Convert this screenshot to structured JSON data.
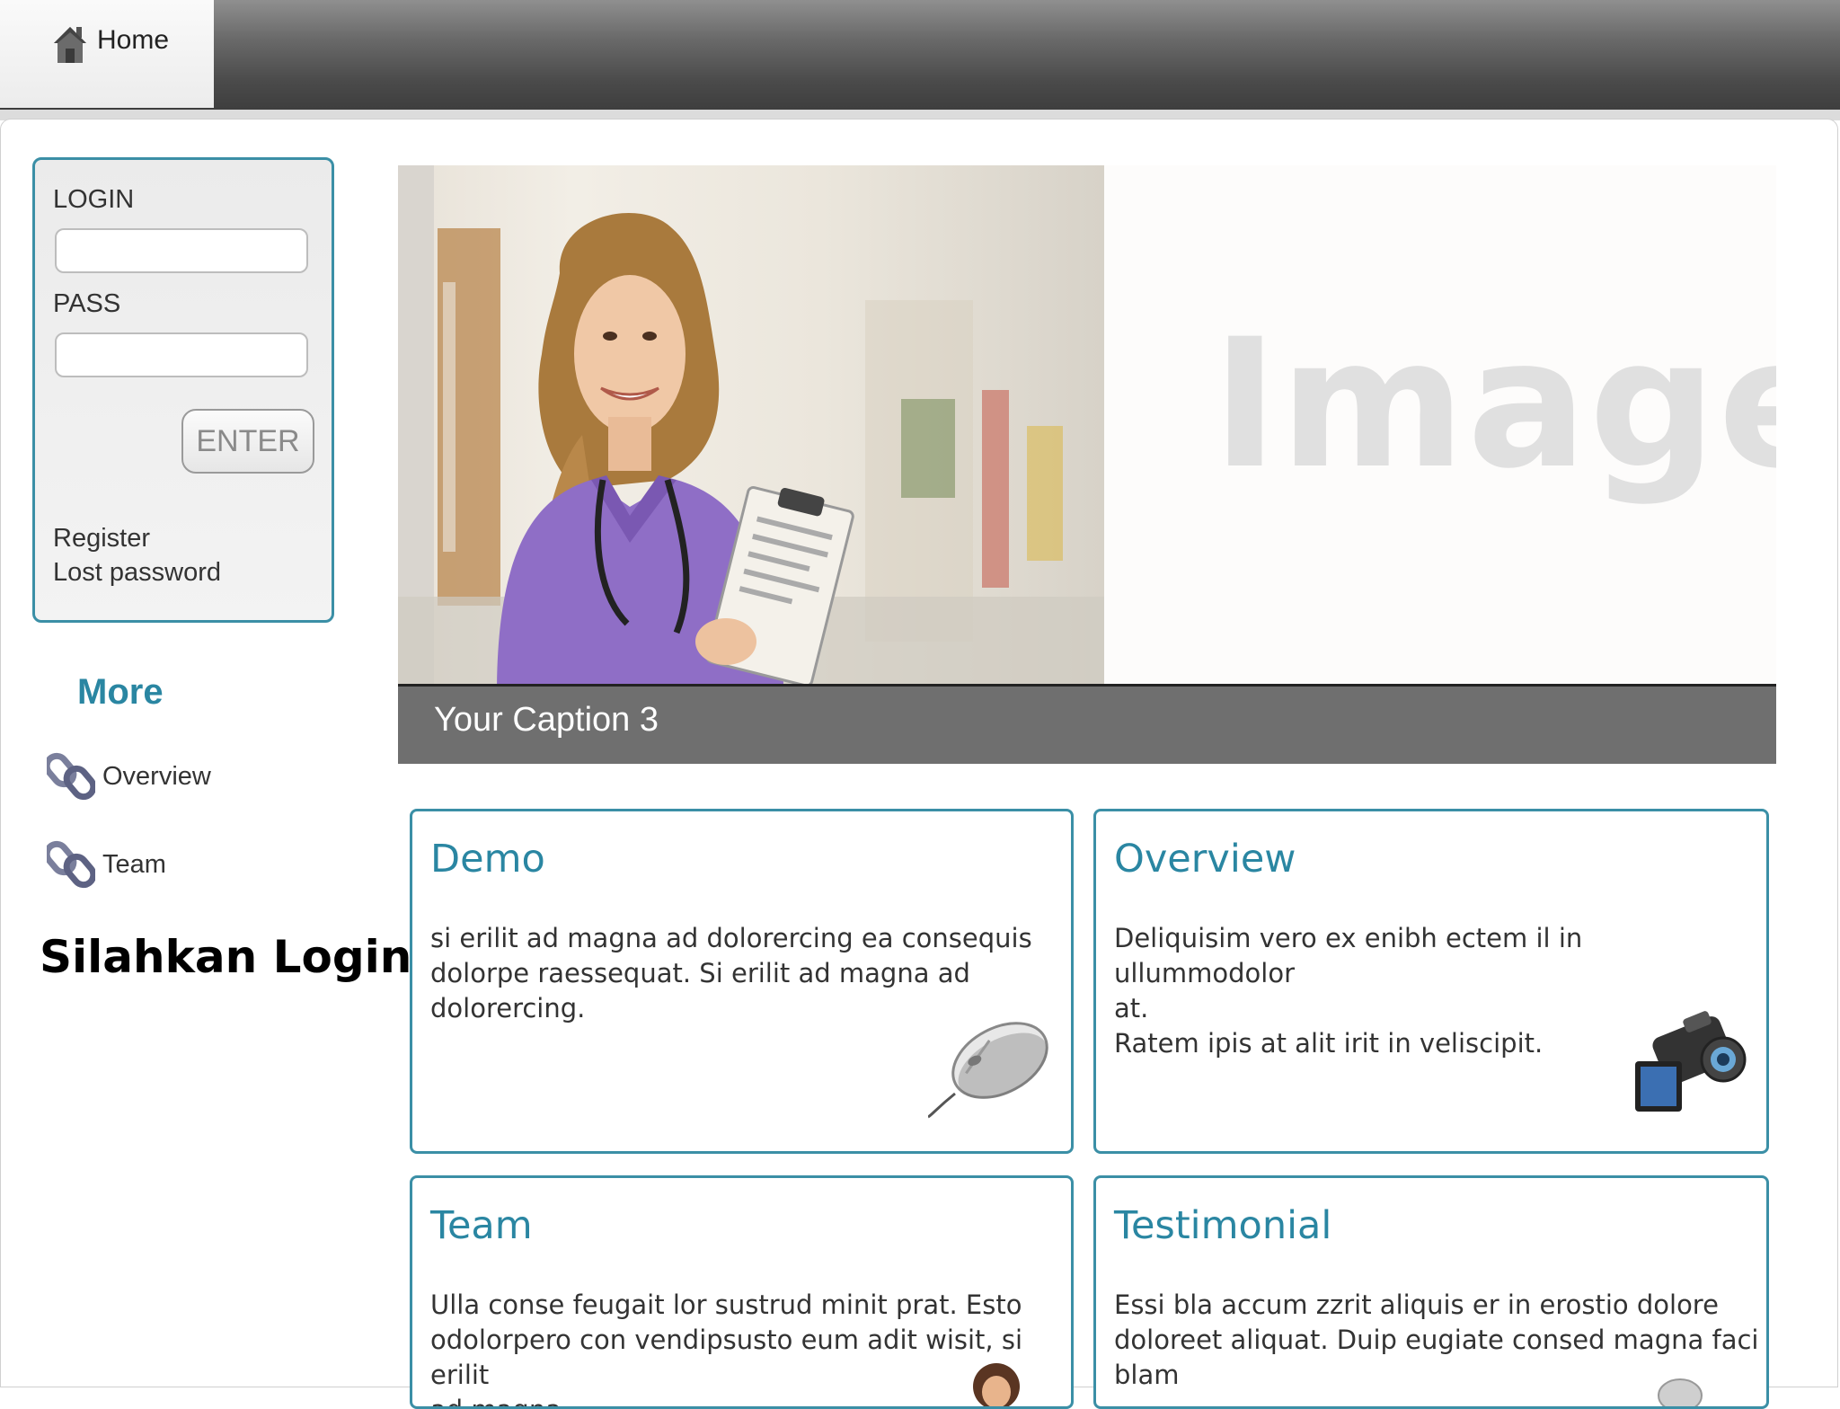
{
  "nav": {
    "home_label": "Home"
  },
  "login": {
    "login_label": "LOGIN",
    "login_value": "",
    "pass_label": "PASS",
    "pass_value": "",
    "enter_label": "ENTER",
    "register_label": "Register",
    "lost_password_label": "Lost password"
  },
  "more": {
    "title": "More",
    "items": [
      {
        "label": "Overview",
        "icon": "chain-link-icon"
      },
      {
        "label": "Team",
        "icon": "chain-link-icon"
      }
    ]
  },
  "login_prompt": "Silahkan Login",
  "slider": {
    "placeholder_text": "Image",
    "caption": "Your Caption 3"
  },
  "cards": [
    {
      "title": "Demo",
      "text": "si erilit ad magna ad dolorercing ea consequis\ndolorpe raessequat. Si erilit ad magna ad\ndolorercing.",
      "icon": "mouse-icon"
    },
    {
      "title": "Overview",
      "text": "Deliquisim vero ex enibh  ectem il in ullummodolor\nat.\nRatem ipis at alit irit in veliscipit.",
      "icon": "video-camera-icon"
    },
    {
      "title": "Team",
      "text": "Ulla conse feugait lor sustrud minit prat. Esto\nodolorpero con vendipsusto eum adit wisit, si erilit\nad magna",
      "icon": "person-icon"
    },
    {
      "title": "Testimonial",
      "text": "Essi bla accum zzrit aliquis er in erostio dolore\ndoloreet aliquat. Duip eugiate consed magna faci\nblam",
      "icon": "testimonial-icon"
    }
  ],
  "colors": {
    "accent": "#2a86a2",
    "border": "#3b8fa6",
    "topbar": "#4a4a4a",
    "caption_bg": "#6f6f6f"
  }
}
